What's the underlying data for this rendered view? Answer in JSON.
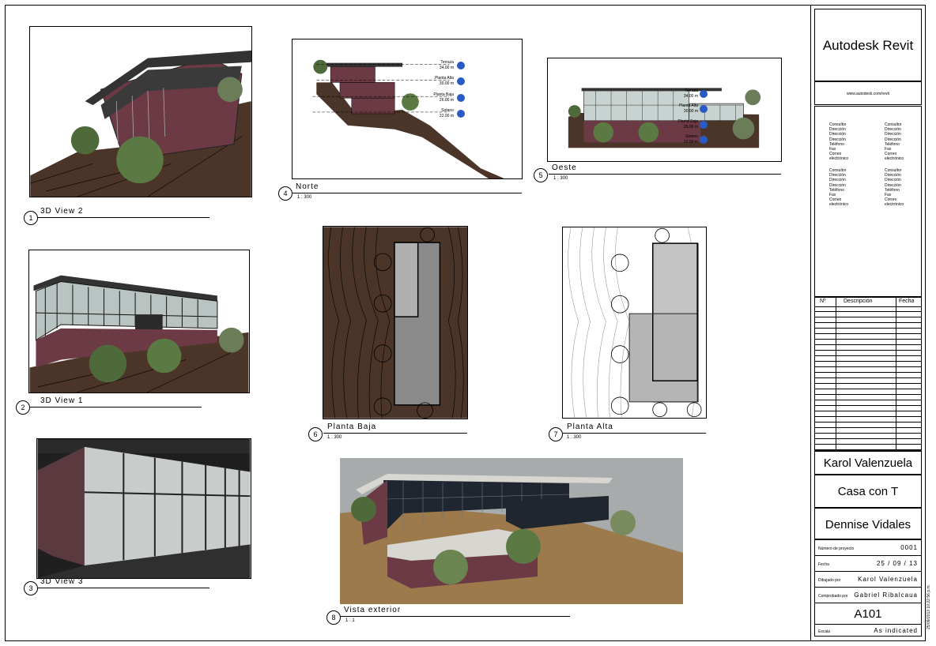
{
  "views": [
    {
      "number": "1",
      "title": "3D View 2",
      "scale": ""
    },
    {
      "number": "2",
      "title": "3D View 1",
      "scale": ""
    },
    {
      "number": "3",
      "title": "3D View 3",
      "scale": ""
    },
    {
      "number": "4",
      "title": "Norte",
      "scale": "1 : 300"
    },
    {
      "number": "5",
      "title": "Oeste",
      "scale": "1 : 300"
    },
    {
      "number": "6",
      "title": "Planta Baja",
      "scale": "1 : 300"
    },
    {
      "number": "7",
      "title": "Planta Alta",
      "scale": "1 : 300"
    },
    {
      "number": "8",
      "title": "Vista exterior",
      "scale": "1 : 1"
    }
  ],
  "levels": [
    {
      "name": "Terraza",
      "elev": "34.00 m"
    },
    {
      "name": "Planta Alta",
      "elev": "30.00 m"
    },
    {
      "name": "Planta Baja",
      "elev": "26.00 m"
    },
    {
      "name": "Sotano",
      "elev": "22.00 m"
    }
  ],
  "levels_oeste": [
    {
      "name": "Terraza",
      "elev": "34.00 m"
    },
    {
      "name": "Planta Alta",
      "elev": "30.00 m"
    },
    {
      "name": "Planta Baja",
      "elev": "26.00 m"
    },
    {
      "name": "Sotano",
      "elev": "22.00 m"
    }
  ],
  "title_block": {
    "logo": "Autodesk Revit",
    "url": "www.autodesk.com/revit",
    "contact_labels": [
      "Consultor",
      "Dirección",
      "Dirección",
      "Dirección",
      "Teléfono",
      "Fax",
      "Correo",
      "electrónico"
    ],
    "revision_headers": {
      "num": "Nº",
      "desc": "Descripción",
      "date": "Fecha"
    },
    "owner": "Karol Valenzuela",
    "project_name": "Casa con T",
    "sheet_name": "Dennise Vidales",
    "project_number_label": "Número de proyecto",
    "project_number": "0001",
    "date_label": "Fecha",
    "date": "25 / 09 / 13",
    "drawn_by_label": "Dibujado por",
    "drawn_by": "Karol Valenzuela",
    "checked_by_label": "Comprobado por",
    "checked_by": "Gabriel Ribalcaua",
    "sheet_number": "A101",
    "scale_label": "Escala",
    "scale": "As indicated",
    "stamp": "25/09/2013 10:22:56 p.m."
  },
  "colors": {
    "ground": "#4a3528",
    "brick": "#6b3a44",
    "glass": "#b9c4c2",
    "tree": "#4e6a3a",
    "marker": "#2a5bc4"
  }
}
